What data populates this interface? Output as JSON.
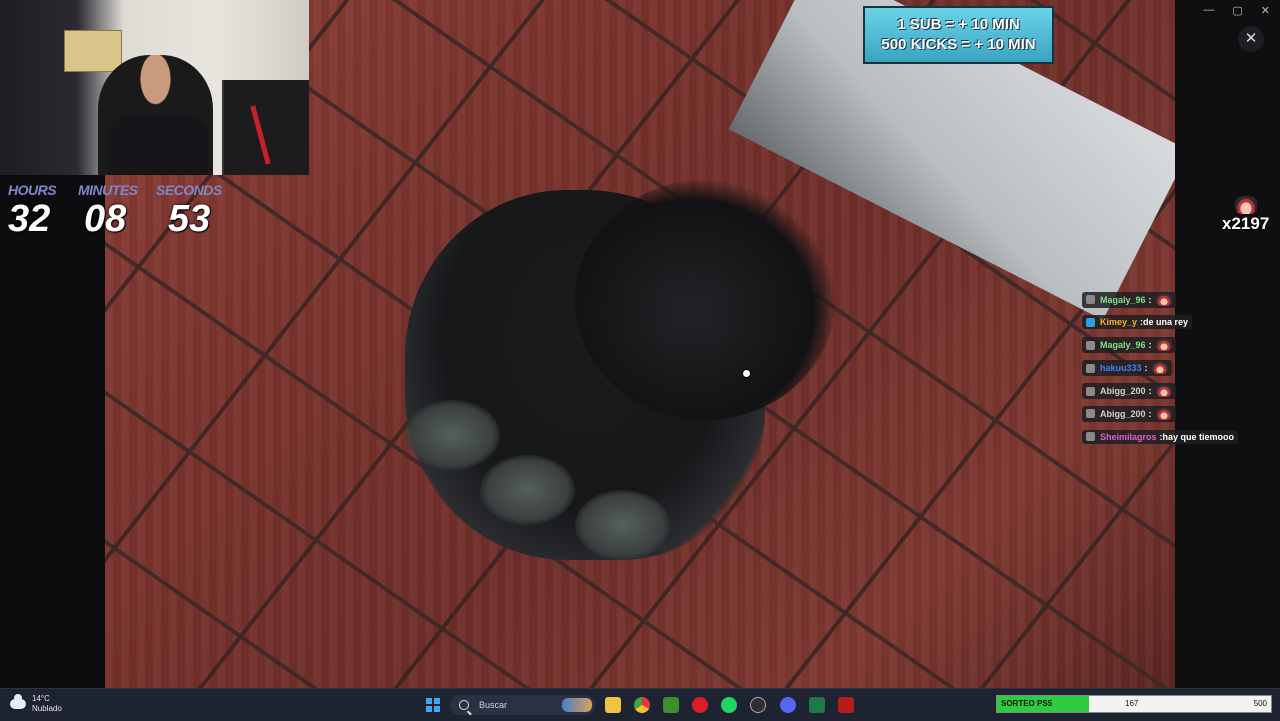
{
  "timer": {
    "hours_label": "HOURS",
    "hours": "32",
    "minutes_label": "MINUTES",
    "minutes": "08",
    "seconds_label": "SECONDS",
    "seconds": "53"
  },
  "banner": {
    "line1": "1 SUB = + 10 MIN",
    "line2": "500 KICKS = + 10 MIN"
  },
  "counter": {
    "value": "x2197"
  },
  "chat": [
    {
      "user": "Magaly_96",
      "color": "#7ee08a",
      "text": "",
      "emote": true,
      "badge": false
    },
    {
      "user": "Kimey_y",
      "color": "#f0b429",
      "text": "de una rey",
      "emote": false,
      "badge": true
    },
    {
      "user": "Magaly_96",
      "color": "#7ee08a",
      "text": "",
      "emote": true,
      "badge": false
    },
    {
      "user": "hakuu333",
      "color": "#3b82f6",
      "text": "",
      "emote": true,
      "badge": false
    },
    {
      "user": "Abigg_200",
      "color": "#d0d0d0",
      "text": "",
      "emote": true,
      "badge": false
    },
    {
      "user": "Abigg_200",
      "color": "#d0d0d0",
      "text": "",
      "emote": true,
      "badge": false
    },
    {
      "user": "Sheimilagros",
      "color": "#e05fd0",
      "text": "hay que tiemooo",
      "emote": false,
      "badge": false
    }
  ],
  "taskbar": {
    "weather_temp": "14°C",
    "weather_desc": "Nublado",
    "search_placeholder": "Buscar",
    "icons": [
      "file-explorer-icon",
      "chrome-icon",
      "minecraft-icon",
      "opera-icon",
      "spotify-icon",
      "obs-icon",
      "discord-icon",
      "app-icon",
      "stream-icon"
    ],
    "ps5": {
      "label": "SORTEO PS5",
      "current": "167",
      "max": "500",
      "progress": 0.334
    }
  },
  "window": {
    "minimize": "—",
    "maximize": "▢",
    "close": "✕"
  }
}
